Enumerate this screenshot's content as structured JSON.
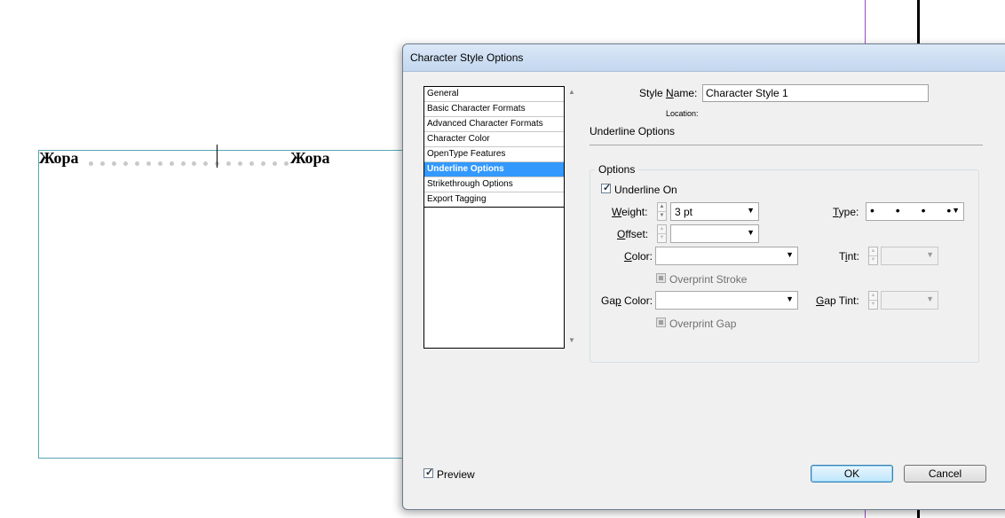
{
  "canvas": {
    "word_left": "Жора",
    "word_right": "Жора"
  },
  "dialog": {
    "title": "Character Style Options",
    "categories": [
      {
        "label": "General"
      },
      {
        "label": "Basic Character Formats"
      },
      {
        "label": "Advanced Character Formats"
      },
      {
        "label": "Character Color"
      },
      {
        "label": "OpenType Features"
      },
      {
        "label": "Underline Options",
        "selected": true
      },
      {
        "label": "Strikethrough Options"
      },
      {
        "label": "Export Tagging"
      }
    ],
    "style_name": {
      "label_pre": "Style ",
      "label_ul": "N",
      "label_post": "ame:",
      "value": "Character Style 1"
    },
    "location": {
      "label": "Location:"
    },
    "section_title": "Underline Options",
    "options_group": {
      "label": "Options"
    },
    "underline_on": {
      "label": "Underline On",
      "checked": true
    },
    "weight": {
      "label_ul": "W",
      "label_post": "eight:",
      "value": "3 pt"
    },
    "type": {
      "label_ul": "T",
      "label_post": "ype:",
      "value": "• • • •"
    },
    "offset": {
      "label_ul": "O",
      "label_post": "ffset:",
      "value": ""
    },
    "color": {
      "label_ul": "C",
      "label_post": "olor:",
      "value": ""
    },
    "tint": {
      "label_pre": "T",
      "label_ul": "i",
      "label_post": "nt:",
      "value": ""
    },
    "overprint_stroke": {
      "label": "Overprint Stroke",
      "checked": false,
      "disabled": true
    },
    "gap_color": {
      "label_pre": "Ga",
      "label_ul": "p",
      "label_post": " Color:",
      "value": ""
    },
    "gap_tint": {
      "label_ul": "G",
      "label_post": "ap Tint:",
      "value": ""
    },
    "overprint_gap": {
      "label": "Overprint Gap",
      "checked": false,
      "disabled": true
    },
    "preview": {
      "label": "Preview",
      "checked": true
    },
    "ok_label": "OK",
    "cancel_label": "Cancel"
  },
  "colors": {
    "selection": "#3399ff",
    "title_bar": "#c3d7ef",
    "guide_purple": "#9b4ac6",
    "frame_edge": "#5aa6b5"
  }
}
